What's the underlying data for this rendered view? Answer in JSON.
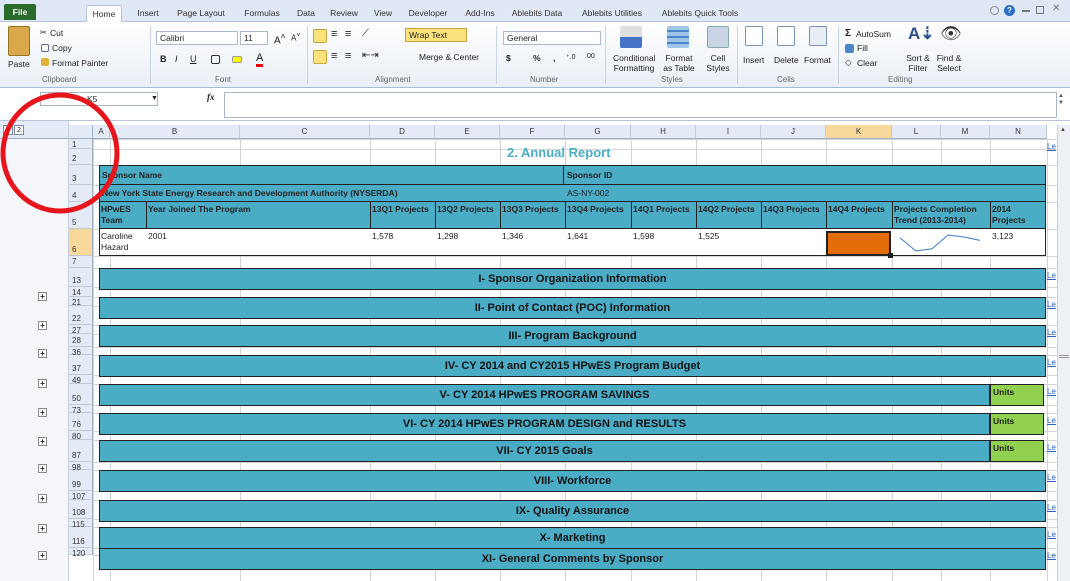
{
  "tabs": [
    "File",
    "Home",
    "Insert",
    "Page Layout",
    "Formulas",
    "Data",
    "Review",
    "View",
    "Developer",
    "Add-Ins",
    "Ablebits Data",
    "Ablebits Utilities",
    "Ablebits Quick Tools"
  ],
  "clipboard": {
    "cut": "Cut",
    "copy": "Copy",
    "paste": "Paste",
    "format_painter": "Format Painter",
    "label": "Clipboard"
  },
  "font": {
    "name": "Calibri",
    "size": "11",
    "label": "Font",
    "bold": "B",
    "italic": "I",
    "underline": "U"
  },
  "alignment": {
    "wrap": "Wrap Text",
    "merge": "Merge & Center",
    "label": "Alignment"
  },
  "number": {
    "format": "General",
    "currency": "$",
    "percent": "%",
    "comma": ",",
    "label": "Number"
  },
  "styles": {
    "conditional": "Conditional Formatting",
    "format_table": "Format as Table",
    "cell_styles": "Cell Styles",
    "label": "Styles",
    "cf1": "Conditional",
    "cf2": "Formatting",
    "ft1": "Format",
    "ft2": "as Table",
    "cs1": "Cell",
    "cs2": "Styles"
  },
  "cells": {
    "insert": "Insert",
    "delete": "Delete",
    "format": "Format",
    "label": "Cells"
  },
  "editing": {
    "autosum": "AutoSum",
    "fill": "Fill",
    "clear": "Clear",
    "sort": "Sort & Filter",
    "find": "Find & Select",
    "label": "Editing",
    "sort1": "Sort &",
    "sort2": "Filter",
    "find1": "Find &",
    "find2": "Select"
  },
  "formula_bar": {
    "name_box": "K5",
    "fx": "fx",
    "value": ""
  },
  "outline_levels": [
    "1",
    "2"
  ],
  "columns": [
    "A",
    "B",
    "C",
    "D",
    "E",
    "F",
    "G",
    "H",
    "I",
    "J",
    "K",
    "L",
    "M",
    "N"
  ],
  "rows": [
    "1",
    "2",
    "3",
    "4",
    "5",
    "6",
    "7",
    "13",
    "14",
    "21",
    "22",
    "27",
    "28",
    "36",
    "37",
    "49",
    "50",
    "73",
    "76",
    "80",
    "87",
    "98",
    "99",
    "107",
    "108",
    "115",
    "116",
    "120"
  ],
  "report": {
    "title": "2. Annual Report",
    "sponsor_name_label": "Sponsor Name",
    "sponsor_id_label": "Sponsor ID",
    "sponsor_name": "New York State Energy Research and Development Authority (NYSERDA)",
    "sponsor_id": "AS-NY-002",
    "headers": [
      "HPwES Team",
      "Year Joined The Program",
      "13Q1 Projects",
      "13Q2 Projects",
      "13Q3 Projects",
      "13Q4 Projects",
      "14Q1 Projects",
      "14Q2 Projects",
      "14Q3 Projects",
      "14Q4 Projects",
      "Projects Completion Trend (2013-2014)",
      "2014 Projects"
    ],
    "h0a": "HPwES",
    "h0b": "Team",
    "h10a": "Projects Completion",
    "h10b": "Trend (2013-2014)",
    "h11a": "2014",
    "h11b": "Projects",
    "row": {
      "team_a": "Caroline",
      "team_b": "Hazard",
      "year": "2001",
      "q131": "1,578",
      "q132": "1,298",
      "q133": "1,346",
      "q134": "1,641",
      "q141": "1,598",
      "q142": "1,525",
      "q143": "",
      "q144": "",
      "total": "3,123"
    },
    "trend": [
      1578,
      1298,
      1346,
      1641,
      1598,
      1525
    ]
  },
  "sections": [
    {
      "label": "I- Sponsor Organization Information",
      "units": ""
    },
    {
      "label": "II- Point of Contact (POC) Information",
      "units": ""
    },
    {
      "label": "III- Program Background",
      "units": ""
    },
    {
      "label": "IV- CY 2014 and CY2015 HPwES Program Budget",
      "units": ""
    },
    {
      "label": "V- CY 2014 HPwES PROGRAM SAVINGS",
      "units": "Units"
    },
    {
      "label": "VI- CY 2014 HPwES PROGRAM DESIGN and RESULTS",
      "units": "Units"
    },
    {
      "label": "VII- CY 2015 Goals",
      "units": "Units"
    },
    {
      "label": "VIII- Workforce",
      "units": ""
    },
    {
      "label": "IX- Quality Assurance",
      "units": ""
    },
    {
      "label": "X- Marketing",
      "units": ""
    },
    {
      "label": "XI- General Comments by Sponsor",
      "units": ""
    }
  ],
  "le_label": "Le",
  "colors": {
    "teal": "#4bacc6",
    "orange": "#e46c0a",
    "green": "#92d050",
    "annotation": "#e8141b"
  }
}
